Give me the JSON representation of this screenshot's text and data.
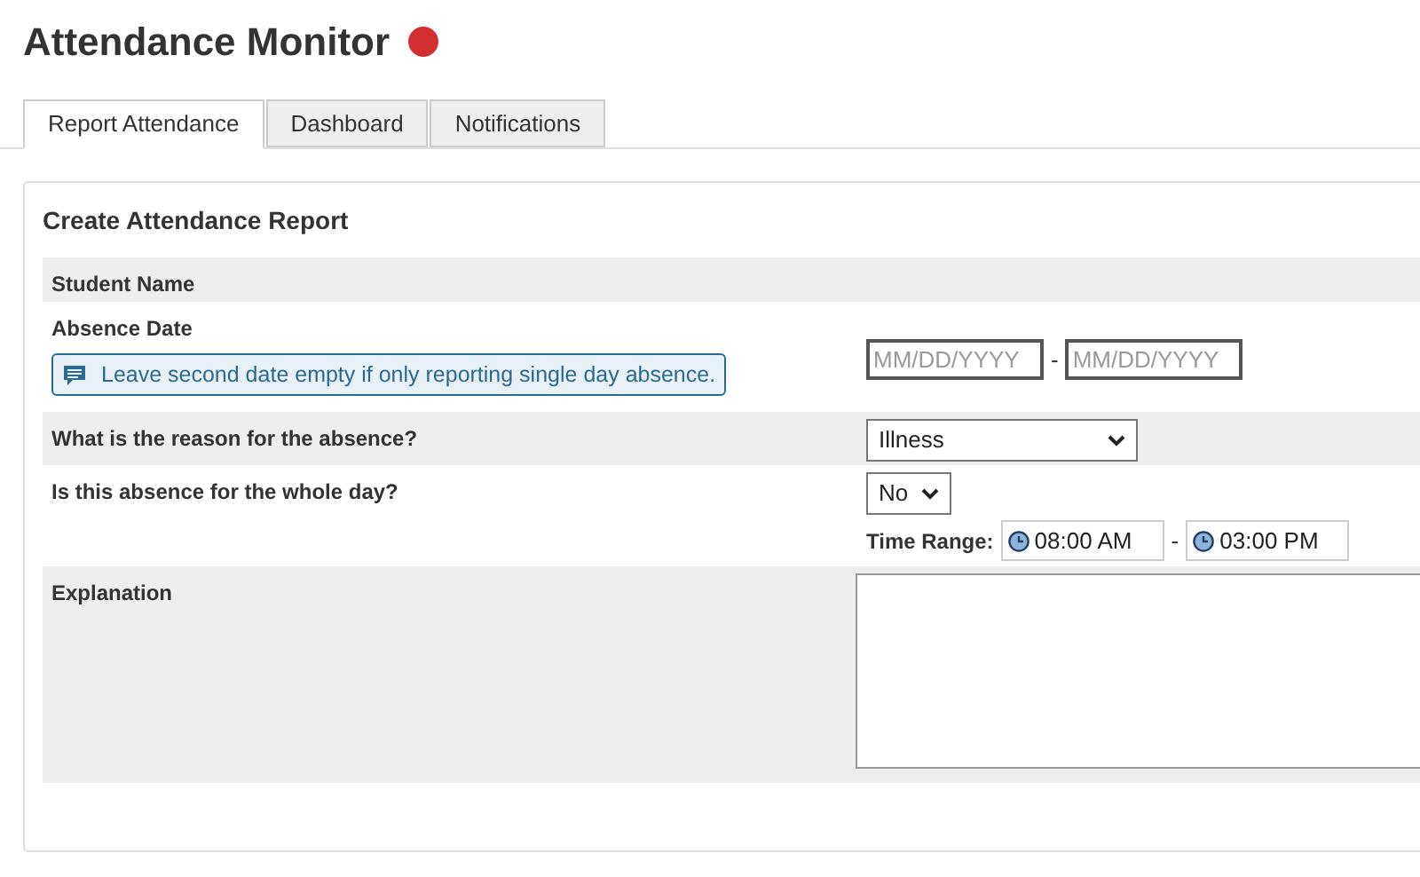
{
  "header": {
    "title": "Attendance Monitor"
  },
  "tabs": [
    {
      "label": "Report Attendance",
      "selected": true
    },
    {
      "label": "Dashboard",
      "selected": false
    },
    {
      "label": "Notifications",
      "selected": false
    }
  ],
  "form": {
    "title": "Create Attendance Report",
    "rows": [
      {
        "kind": "text",
        "label": "Student Name"
      },
      {
        "kind": "date_range",
        "label": "Absence Date",
        "hint": "Leave second date empty if only reporting single day absence.",
        "start": {
          "placeholder": "MM/DD/YYYY"
        },
        "separator": "-",
        "end": {
          "placeholder": "MM/DD/YYYY"
        }
      },
      {
        "kind": "select",
        "label": "What is the reason for the absence?",
        "value": "Illness"
      },
      {
        "kind": "select_time",
        "label": "Is this absence for the whole day?",
        "value": "No",
        "time_label": "Time Range:",
        "start": "08:00 AM",
        "separator": "-",
        "end": "03:00 PM"
      },
      {
        "kind": "textarea",
        "label": "Explanation"
      }
    ]
  }
}
